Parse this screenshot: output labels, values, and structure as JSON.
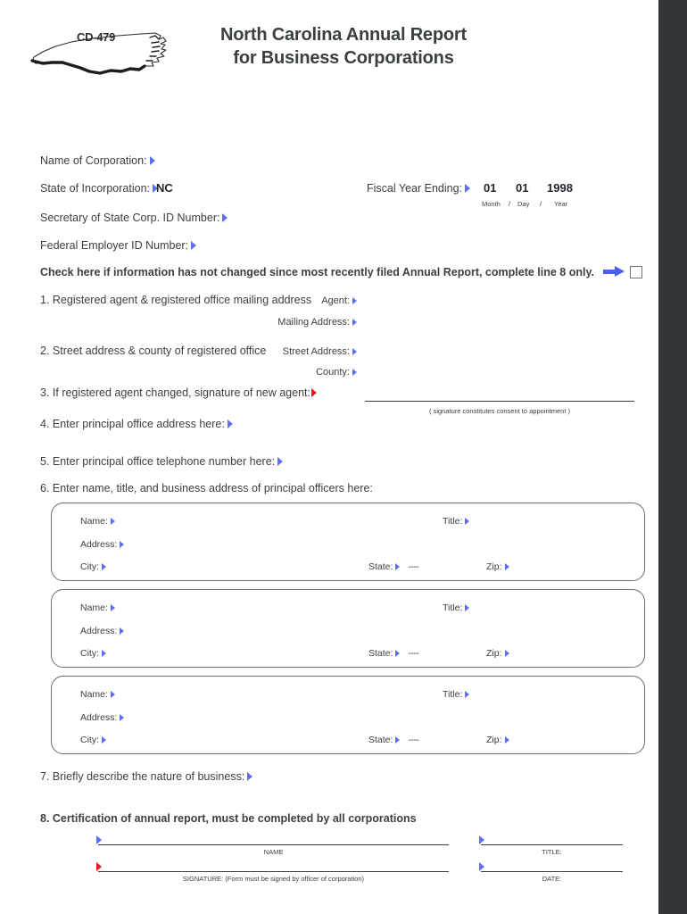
{
  "document": {
    "form_code": "CD-479",
    "title_line1": "North Carolina Annual Report",
    "title_line2": "for Business Corporations",
    "logo_icon": "north-carolina-state-outline-icon"
  },
  "identity": {
    "name_of_corporation_label": "Name of Corporation:",
    "state_of_incorporation_label": "State of Incorporation:",
    "state_of_incorporation_value": "NC",
    "secretary_id_label": "Secretary of State Corp. ID Number:",
    "federal_employer_id_label": "Federal Employer ID Number:"
  },
  "fiscal_year": {
    "label": "Fiscal Year Ending:",
    "month": "01",
    "day": "01",
    "year": "1998",
    "month_caption": "Month",
    "day_caption": "Day",
    "year_caption": "Year",
    "sep1": "/",
    "sep2": "/"
  },
  "no_change": {
    "text": "Check here if information has not changed since most recently filed Annual Report, complete line 8 only.",
    "arrow_icon": "blue-right-arrow-icon",
    "checkbox_checked": false
  },
  "lines": {
    "l1_text": "1. Registered agent & registered office mailing address",
    "l1_agent_label": "Agent:",
    "l1_mailing_label": "Mailing Address:",
    "l2_text": "2. Street address & county of registered office",
    "l2_street_label": "Street Address:",
    "l2_county_label": "County:",
    "l3_text": "3. If registered agent changed, signature of new agent:",
    "l3_caption": "( signature constitutes consent to appointment )",
    "l4_text": "4. Enter principal office address here:",
    "l5_text": "5. Enter principal office telephone number here:",
    "l6_text": "6. Enter name, title, and business address of principal officers here:",
    "l7_text": "7. Briefly describe the nature of business:",
    "l8_text": "8. Certification of annual report, must be completed by all corporations"
  },
  "officer_fields": {
    "name_label": "Name:",
    "title_label": "Title:",
    "address_label": "Address:",
    "city_label": "City:",
    "state_label": "State:",
    "state_placeholder": "----",
    "zip_label": "Zip:"
  },
  "officers": [
    {
      "index": 1
    },
    {
      "index": 2
    },
    {
      "index": 3
    }
  ],
  "certification": {
    "name_caption": "NAME",
    "title_caption": "TITLE:",
    "signature_caption": "SIGNATURE: (Form must be signed by officer of corporation)",
    "date_caption": "DATE:"
  },
  "colors": {
    "field_marker_blue": "#5b6ef5",
    "signature_marker_red": "#e01b1b",
    "arrow_blue": "#4a5ef0",
    "text": "#3c4043",
    "right_band": "#303638"
  }
}
